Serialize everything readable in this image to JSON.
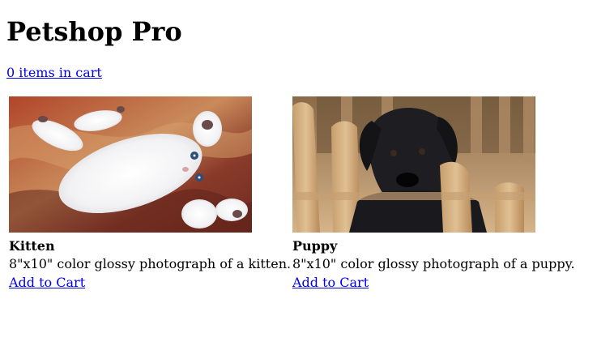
{
  "page": {
    "title": "Petshop Pro",
    "cart_link": "0 items in cart"
  },
  "products": [
    {
      "name": "Kitten",
      "description": "8\"x10\" color glossy photograph of a kitten.",
      "add_label": "Add to Cart",
      "image_icon": "kitten-photo"
    },
    {
      "name": "Puppy",
      "description": "8\"x10\" color glossy photograph of a puppy.",
      "add_label": "Add to Cart",
      "image_icon": "puppy-photo"
    }
  ],
  "colors": {
    "link": "#0000ee",
    "text": "#000000",
    "background": "#ffffff"
  }
}
